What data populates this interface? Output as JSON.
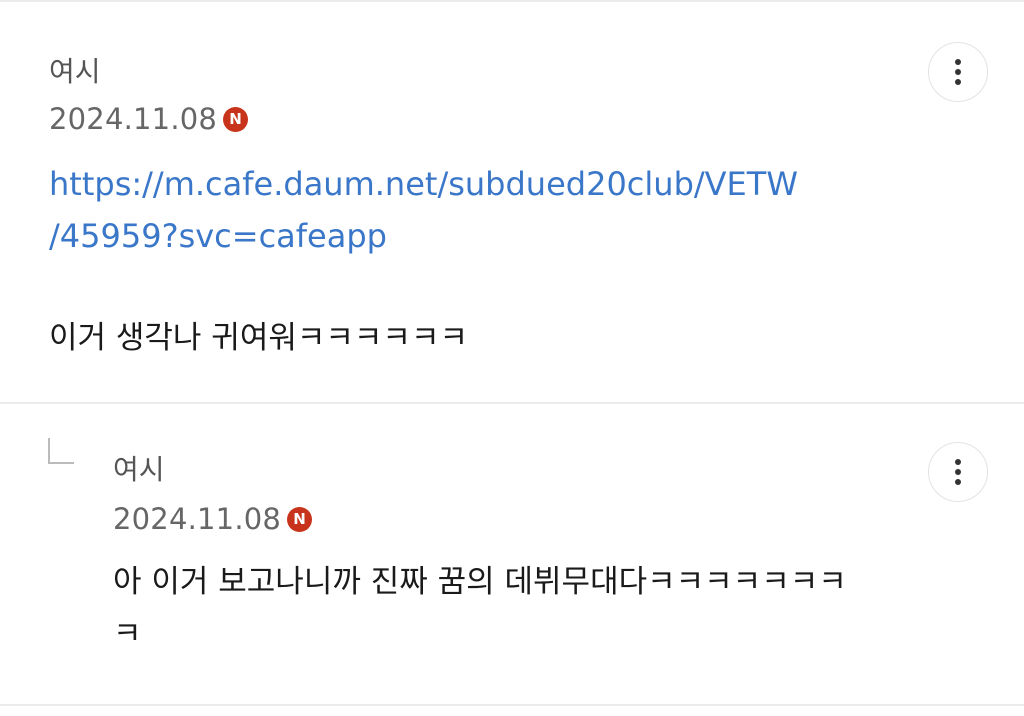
{
  "comments": [
    {
      "author": "여시",
      "date": "2024.11.08",
      "new_badge": "N",
      "link_line1": "https://m.cafe.daum.net/subdued20club/VETW",
      "link_line2": "/45959?svc=cafeapp",
      "text_line1": "이거 생각나 귀여워ㅋㅋㅋㅋㅋㅋ",
      "more_icon": "more-vertical-icon"
    },
    {
      "author": "여시",
      "date": "2024.11.08",
      "new_badge": "N",
      "text_line1": "아 이거 보고나니까 진짜 꿈의 데뷔무대다ㅋㅋㅋㅋㅋㅋㅋ",
      "text_line2": "ㅋ",
      "reply_icon": "reply-arrow-icon",
      "more_icon": "more-vertical-icon"
    }
  ],
  "colors": {
    "link": "#3a77c9",
    "badge": "#c8341b",
    "divider": "#ececec"
  }
}
